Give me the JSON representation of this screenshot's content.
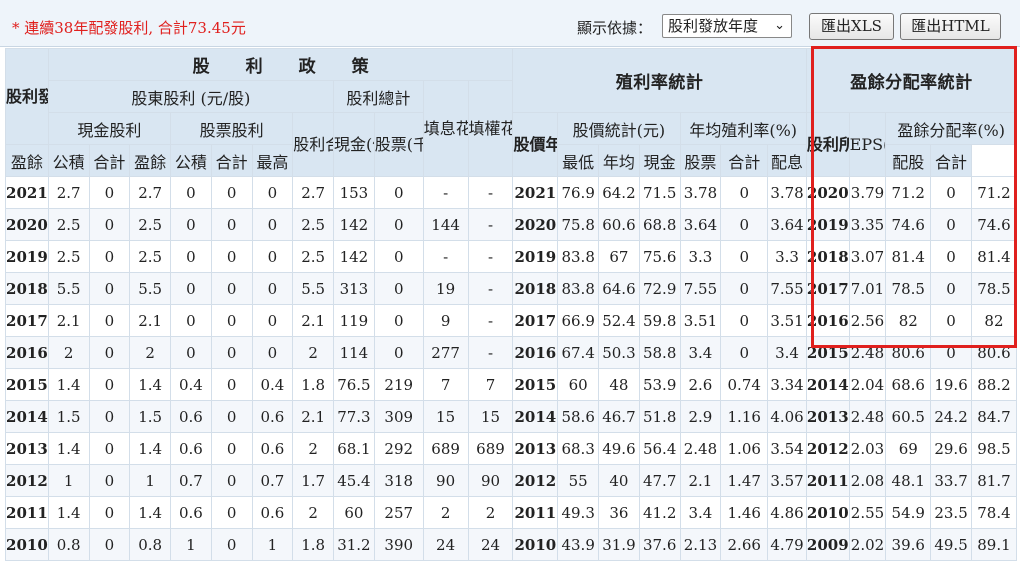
{
  "toolbar": {
    "summary": "* 連續38年配發股利, 合計73.45元",
    "sort_label": "顯示依據：",
    "sort_value": "股利發放年度",
    "export_xls": "匯出XLS",
    "export_html": "匯出HTML"
  },
  "headers": {
    "dividend_policy": "股利政策",
    "payout_year": "股利發放年度",
    "shareholder_dividend": "股東股利 (元/股)",
    "dividend_total": "股利總計",
    "ex_dividend_days": "填息花費日數",
    "ex_right_days": "填權花費日數",
    "cash_dividend": "現金股利",
    "stock_dividend": "股票股利",
    "dividend_sum": "股利合計",
    "cash_billion": "現金(億)",
    "stock_kshares": "股票(千張)",
    "earnings": "盈餘",
    "capital_reserve": "公積",
    "subtotal": "合計",
    "yield_stats": "殖利率統計",
    "price_year": "股價年度",
    "price_stats": "股價統計(元)",
    "annual_yield": "年均殖利率(%)",
    "high": "最高",
    "low": "最低",
    "average": "年均",
    "cash": "現金",
    "stock": "股票",
    "payout_stats": "盈餘分配率統計",
    "earning_period": "股利所屬期間",
    "eps": "EPS(元)",
    "payout_ratio": "盈餘分配率(%)",
    "payout_dist": "配息",
    "payout_stock": "配股"
  },
  "rows": [
    {
      "year": "2021",
      "ce": "2.7",
      "cr": "0",
      "ct": "2.7",
      "se": "0",
      "sr": "0",
      "st": "0",
      "tot": "2.7",
      "cash": "153",
      "stk": "0",
      "fx": "-",
      "fq": "-",
      "py": "2021",
      "hi": "76.9",
      "lo": "64.2",
      "avg": "71.5",
      "yc": "3.78",
      "ys": "0",
      "yt": "3.78",
      "ep": "2020",
      "eps": "3.79",
      "rd": "71.2",
      "rs": "0",
      "rt": "71.2"
    },
    {
      "year": "2020",
      "ce": "2.5",
      "cr": "0",
      "ct": "2.5",
      "se": "0",
      "sr": "0",
      "st": "0",
      "tot": "2.5",
      "cash": "142",
      "stk": "0",
      "fx": "144",
      "fq": "-",
      "py": "2020",
      "hi": "75.8",
      "lo": "60.6",
      "avg": "68.8",
      "yc": "3.64",
      "ys": "0",
      "yt": "3.64",
      "ep": "2019",
      "eps": "3.35",
      "rd": "74.6",
      "rs": "0",
      "rt": "74.6"
    },
    {
      "year": "2019",
      "ce": "2.5",
      "cr": "0",
      "ct": "2.5",
      "se": "0",
      "sr": "0",
      "st": "0",
      "tot": "2.5",
      "cash": "142",
      "stk": "0",
      "fx": "-",
      "fq": "-",
      "py": "2019",
      "hi": "83.8",
      "lo": "67",
      "avg": "75.6",
      "yc": "3.3",
      "ys": "0",
      "yt": "3.3",
      "ep": "2018",
      "eps": "3.07",
      "rd": "81.4",
      "rs": "0",
      "rt": "81.4"
    },
    {
      "year": "2018",
      "ce": "5.5",
      "cr": "0",
      "ct": "5.5",
      "se": "0",
      "sr": "0",
      "st": "0",
      "tot": "5.5",
      "cash": "313",
      "stk": "0",
      "fx": "19",
      "fq": "-",
      "py": "2018",
      "hi": "83.8",
      "lo": "64.6",
      "avg": "72.9",
      "yc": "7.55",
      "ys": "0",
      "yt": "7.55",
      "ep": "2017",
      "eps": "7.01",
      "rd": "78.5",
      "rs": "0",
      "rt": "78.5"
    },
    {
      "year": "2017",
      "ce": "2.1",
      "cr": "0",
      "ct": "2.1",
      "se": "0",
      "sr": "0",
      "st": "0",
      "tot": "2.1",
      "cash": "119",
      "stk": "0",
      "fx": "9",
      "fq": "-",
      "py": "2017",
      "hi": "66.9",
      "lo": "52.4",
      "avg": "59.8",
      "yc": "3.51",
      "ys": "0",
      "yt": "3.51",
      "ep": "2016",
      "eps": "2.56",
      "rd": "82",
      "rs": "0",
      "rt": "82"
    },
    {
      "year": "2016",
      "ce": "2",
      "cr": "0",
      "ct": "2",
      "se": "0",
      "sr": "0",
      "st": "0",
      "tot": "2",
      "cash": "114",
      "stk": "0",
      "fx": "277",
      "fq": "-",
      "py": "2016",
      "hi": "67.4",
      "lo": "50.3",
      "avg": "58.8",
      "yc": "3.4",
      "ys": "0",
      "yt": "3.4",
      "ep": "2015",
      "eps": "2.48",
      "rd": "80.6",
      "rs": "0",
      "rt": "80.6"
    },
    {
      "year": "2015",
      "ce": "1.4",
      "cr": "0",
      "ct": "1.4",
      "se": "0.4",
      "sr": "0",
      "st": "0.4",
      "tot": "1.8",
      "cash": "76.5",
      "stk": "219",
      "fx": "7",
      "fq": "7",
      "py": "2015",
      "hi": "60",
      "lo": "48",
      "avg": "53.9",
      "yc": "2.6",
      "ys": "0.74",
      "yt": "3.34",
      "ep": "2014",
      "eps": "2.04",
      "rd": "68.6",
      "rs": "19.6",
      "rt": "88.2"
    },
    {
      "year": "2014",
      "ce": "1.5",
      "cr": "0",
      "ct": "1.5",
      "se": "0.6",
      "sr": "0",
      "st": "0.6",
      "tot": "2.1",
      "cash": "77.3",
      "stk": "309",
      "fx": "15",
      "fq": "15",
      "py": "2014",
      "hi": "58.6",
      "lo": "46.7",
      "avg": "51.8",
      "yc": "2.9",
      "ys": "1.16",
      "yt": "4.06",
      "ep": "2013",
      "eps": "2.48",
      "rd": "60.5",
      "rs": "24.2",
      "rt": "84.7"
    },
    {
      "year": "2013",
      "ce": "1.4",
      "cr": "0",
      "ct": "1.4",
      "se": "0.6",
      "sr": "0",
      "st": "0.6",
      "tot": "2",
      "cash": "68.1",
      "stk": "292",
      "fx": "689",
      "fq": "689",
      "py": "2013",
      "hi": "68.3",
      "lo": "49.6",
      "avg": "56.4",
      "yc": "2.48",
      "ys": "1.06",
      "yt": "3.54",
      "ep": "2012",
      "eps": "2.03",
      "rd": "69",
      "rs": "29.6",
      "rt": "98.5"
    },
    {
      "year": "2012",
      "ce": "1",
      "cr": "0",
      "ct": "1",
      "se": "0.7",
      "sr": "0",
      "st": "0.7",
      "tot": "1.7",
      "cash": "45.4",
      "stk": "318",
      "fx": "90",
      "fq": "90",
      "py": "2012",
      "hi": "55",
      "lo": "40",
      "avg": "47.7",
      "yc": "2.1",
      "ys": "1.47",
      "yt": "3.57",
      "ep": "2011",
      "eps": "2.08",
      "rd": "48.1",
      "rs": "33.7",
      "rt": "81.7"
    },
    {
      "year": "2011",
      "ce": "1.4",
      "cr": "0",
      "ct": "1.4",
      "se": "0.6",
      "sr": "0",
      "st": "0.6",
      "tot": "2",
      "cash": "60",
      "stk": "257",
      "fx": "2",
      "fq": "2",
      "py": "2011",
      "hi": "49.3",
      "lo": "36",
      "avg": "41.2",
      "yc": "3.4",
      "ys": "1.46",
      "yt": "4.86",
      "ep": "2010",
      "eps": "2.55",
      "rd": "54.9",
      "rs": "23.5",
      "rt": "78.4"
    },
    {
      "year": "2010",
      "ce": "0.8",
      "cr": "0",
      "ct": "0.8",
      "se": "1",
      "sr": "0",
      "st": "1",
      "tot": "1.8",
      "cash": "31.2",
      "stk": "390",
      "fx": "24",
      "fq": "24",
      "py": "2010",
      "hi": "43.9",
      "lo": "31.9",
      "avg": "37.6",
      "yc": "2.13",
      "ys": "2.66",
      "yt": "4.79",
      "ep": "2009",
      "eps": "2.02",
      "rd": "39.6",
      "rs": "49.5",
      "rt": "89.1"
    }
  ]
}
